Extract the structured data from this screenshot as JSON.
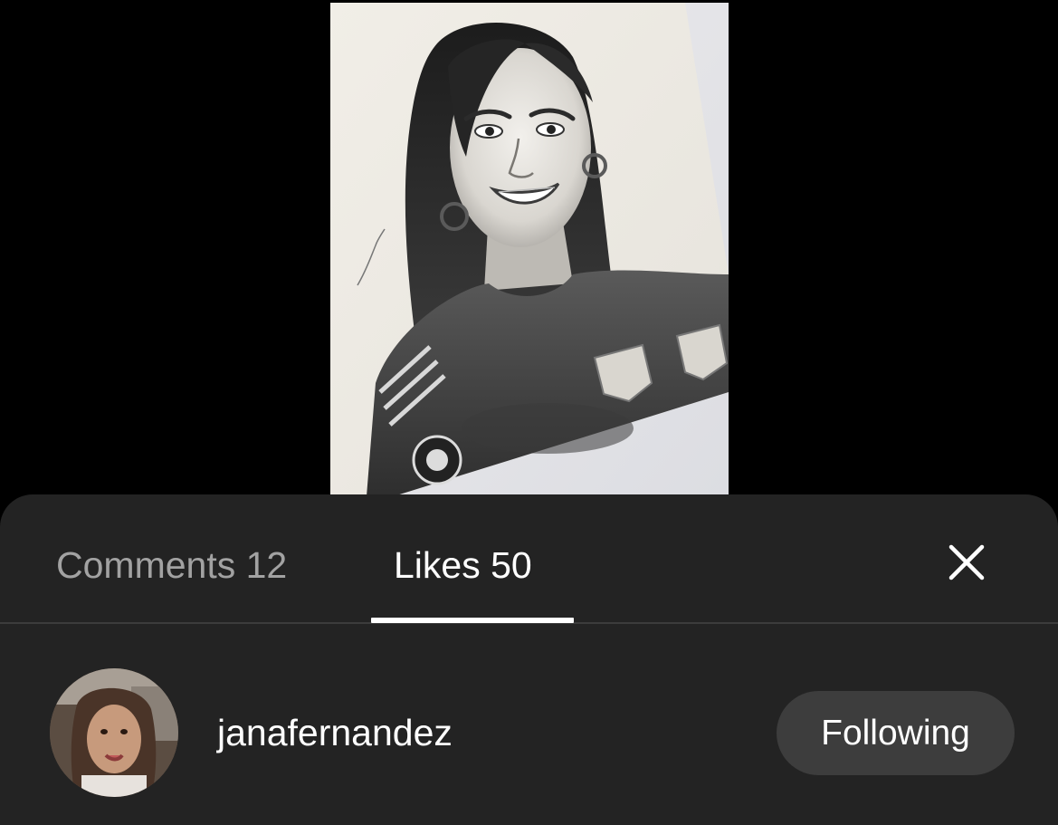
{
  "media": {
    "image": "pencil-drawing-portrait",
    "colors": {
      "backdrop": "#e9e9ec",
      "paper": "#efede6"
    }
  },
  "sheet": {
    "tabs": [
      {
        "label": "Comments 12",
        "selected": false
      },
      {
        "label": "Likes 50",
        "selected": true
      }
    ],
    "close_icon": "close-icon",
    "colors": {
      "background": "#232323",
      "divider": "#3c3c3c",
      "inactive_tab": "#a2a2a2",
      "active_tab": "#ffffff",
      "button_bg": "#3d3d3d"
    }
  },
  "likes": [
    {
      "username": "janafernandez",
      "button_label": "Following",
      "avatar": "user-avatar-photo"
    }
  ]
}
